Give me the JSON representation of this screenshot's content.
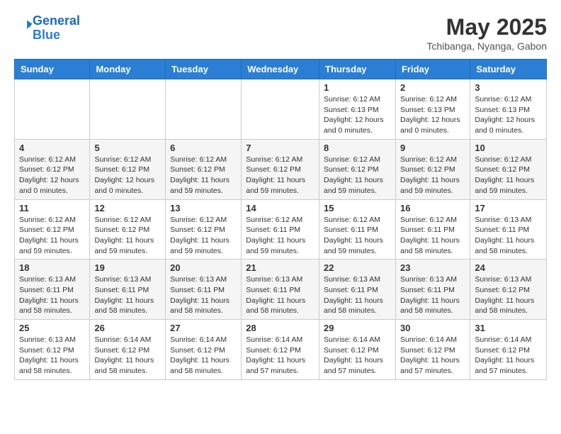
{
  "logo": {
    "line1": "General",
    "line2": "Blue"
  },
  "title": "May 2025",
  "subtitle": "Tchibanga, Nyanga, Gabon",
  "days_of_week": [
    "Sunday",
    "Monday",
    "Tuesday",
    "Wednesday",
    "Thursday",
    "Friday",
    "Saturday"
  ],
  "weeks": [
    [
      {
        "num": "",
        "info": ""
      },
      {
        "num": "",
        "info": ""
      },
      {
        "num": "",
        "info": ""
      },
      {
        "num": "",
        "info": ""
      },
      {
        "num": "1",
        "info": "Sunrise: 6:12 AM\nSunset: 6:13 PM\nDaylight: 12 hours and 0 minutes."
      },
      {
        "num": "2",
        "info": "Sunrise: 6:12 AM\nSunset: 6:13 PM\nDaylight: 12 hours and 0 minutes."
      },
      {
        "num": "3",
        "info": "Sunrise: 6:12 AM\nSunset: 6:13 PM\nDaylight: 12 hours and 0 minutes."
      }
    ],
    [
      {
        "num": "4",
        "info": "Sunrise: 6:12 AM\nSunset: 6:12 PM\nDaylight: 12 hours and 0 minutes."
      },
      {
        "num": "5",
        "info": "Sunrise: 6:12 AM\nSunset: 6:12 PM\nDaylight: 12 hours and 0 minutes."
      },
      {
        "num": "6",
        "info": "Sunrise: 6:12 AM\nSunset: 6:12 PM\nDaylight: 11 hours and 59 minutes."
      },
      {
        "num": "7",
        "info": "Sunrise: 6:12 AM\nSunset: 6:12 PM\nDaylight: 11 hours and 59 minutes."
      },
      {
        "num": "8",
        "info": "Sunrise: 6:12 AM\nSunset: 6:12 PM\nDaylight: 11 hours and 59 minutes."
      },
      {
        "num": "9",
        "info": "Sunrise: 6:12 AM\nSunset: 6:12 PM\nDaylight: 11 hours and 59 minutes."
      },
      {
        "num": "10",
        "info": "Sunrise: 6:12 AM\nSunset: 6:12 PM\nDaylight: 11 hours and 59 minutes."
      }
    ],
    [
      {
        "num": "11",
        "info": "Sunrise: 6:12 AM\nSunset: 6:12 PM\nDaylight: 11 hours and 59 minutes."
      },
      {
        "num": "12",
        "info": "Sunrise: 6:12 AM\nSunset: 6:12 PM\nDaylight: 11 hours and 59 minutes."
      },
      {
        "num": "13",
        "info": "Sunrise: 6:12 AM\nSunset: 6:12 PM\nDaylight: 11 hours and 59 minutes."
      },
      {
        "num": "14",
        "info": "Sunrise: 6:12 AM\nSunset: 6:11 PM\nDaylight: 11 hours and 59 minutes."
      },
      {
        "num": "15",
        "info": "Sunrise: 6:12 AM\nSunset: 6:11 PM\nDaylight: 11 hours and 59 minutes."
      },
      {
        "num": "16",
        "info": "Sunrise: 6:12 AM\nSunset: 6:11 PM\nDaylight: 11 hours and 58 minutes."
      },
      {
        "num": "17",
        "info": "Sunrise: 6:13 AM\nSunset: 6:11 PM\nDaylight: 11 hours and 58 minutes."
      }
    ],
    [
      {
        "num": "18",
        "info": "Sunrise: 6:13 AM\nSunset: 6:11 PM\nDaylight: 11 hours and 58 minutes."
      },
      {
        "num": "19",
        "info": "Sunrise: 6:13 AM\nSunset: 6:11 PM\nDaylight: 11 hours and 58 minutes."
      },
      {
        "num": "20",
        "info": "Sunrise: 6:13 AM\nSunset: 6:11 PM\nDaylight: 11 hours and 58 minutes."
      },
      {
        "num": "21",
        "info": "Sunrise: 6:13 AM\nSunset: 6:11 PM\nDaylight: 11 hours and 58 minutes."
      },
      {
        "num": "22",
        "info": "Sunrise: 6:13 AM\nSunset: 6:11 PM\nDaylight: 11 hours and 58 minutes."
      },
      {
        "num": "23",
        "info": "Sunrise: 6:13 AM\nSunset: 6:11 PM\nDaylight: 11 hours and 58 minutes."
      },
      {
        "num": "24",
        "info": "Sunrise: 6:13 AM\nSunset: 6:12 PM\nDaylight: 11 hours and 58 minutes."
      }
    ],
    [
      {
        "num": "25",
        "info": "Sunrise: 6:13 AM\nSunset: 6:12 PM\nDaylight: 11 hours and 58 minutes."
      },
      {
        "num": "26",
        "info": "Sunrise: 6:14 AM\nSunset: 6:12 PM\nDaylight: 11 hours and 58 minutes."
      },
      {
        "num": "27",
        "info": "Sunrise: 6:14 AM\nSunset: 6:12 PM\nDaylight: 11 hours and 58 minutes."
      },
      {
        "num": "28",
        "info": "Sunrise: 6:14 AM\nSunset: 6:12 PM\nDaylight: 11 hours and 57 minutes."
      },
      {
        "num": "29",
        "info": "Sunrise: 6:14 AM\nSunset: 6:12 PM\nDaylight: 11 hours and 57 minutes."
      },
      {
        "num": "30",
        "info": "Sunrise: 6:14 AM\nSunset: 6:12 PM\nDaylight: 11 hours and 57 minutes."
      },
      {
        "num": "31",
        "info": "Sunrise: 6:14 AM\nSunset: 6:12 PM\nDaylight: 11 hours and 57 minutes."
      }
    ]
  ]
}
